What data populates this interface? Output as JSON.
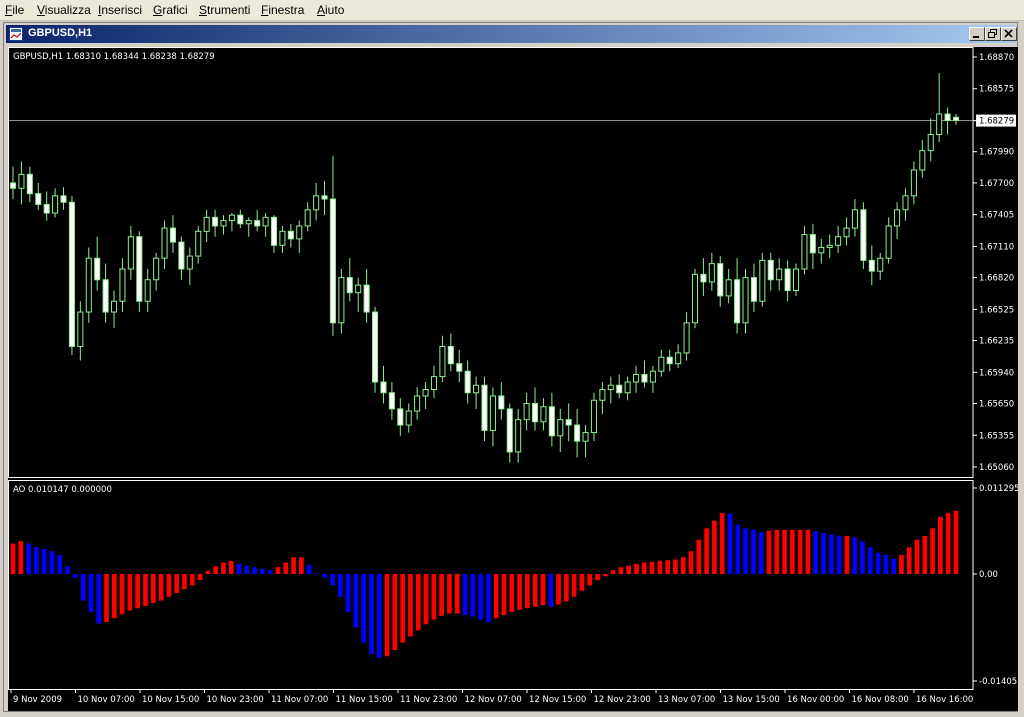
{
  "menu": {
    "items": [
      {
        "label": "File",
        "mn": "F",
        "rest": "ile"
      },
      {
        "label": "Visualizza",
        "mn": "V",
        "rest": "isualizza"
      },
      {
        "label": "Inserisci",
        "mn": "I",
        "rest": "nserisci"
      },
      {
        "label": "Grafici",
        "mn": "G",
        "rest": "rafici"
      },
      {
        "label": "Strumenti",
        "mn": "S",
        "rest": "trumenti"
      },
      {
        "label": "Finestra",
        "mn": "F",
        "rest": "inestra"
      },
      {
        "label": "Aiuto",
        "mn": "A",
        "rest": "iuto"
      }
    ]
  },
  "window": {
    "title": "GBPUSD,H1",
    "icon": "chart-window-icon",
    "buttons": [
      "minimize-icon",
      "restore-icon",
      "close-icon"
    ]
  },
  "chart_data": [
    {
      "type": "candlestick",
      "info": "GBPUSD,H1  1.68310 1.68344 1.68238 1.68279",
      "ylim": [
        1.6506,
        1.6887
      ],
      "yticks": [
        "1.68870",
        "1.68575",
        "1.68279",
        "1.67990",
        "1.67700",
        "1.67405",
        "1.67110",
        "1.66820",
        "1.66525",
        "1.66235",
        "1.65940",
        "1.65650",
        "1.65355",
        "1.65060"
      ],
      "current_price": "1.68279",
      "current_price_value": 1.68279,
      "colors": {
        "up": "#90ee90",
        "down": "#90ee90",
        "body_up": "#000000",
        "body_down": "#ffffff",
        "price_line": "#c0c0c0",
        "axis": "#ffffff"
      },
      "candles": [
        [
          1.677,
          1.6785,
          1.6755,
          1.6765
        ],
        [
          1.6765,
          1.679,
          1.675,
          1.6778
        ],
        [
          1.6778,
          1.6785,
          1.6752,
          1.676
        ],
        [
          1.676,
          1.677,
          1.6745,
          1.675
        ],
        [
          1.675,
          1.6762,
          1.6735,
          1.6742
        ],
        [
          1.6742,
          1.6765,
          1.6738,
          1.6758
        ],
        [
          1.6758,
          1.6766,
          1.6745,
          1.6752
        ],
        [
          1.6752,
          1.6758,
          1.661,
          1.6618
        ],
        [
          1.6618,
          1.666,
          1.6605,
          1.665
        ],
        [
          1.665,
          1.671,
          1.664,
          1.67
        ],
        [
          1.67,
          1.672,
          1.667,
          1.668
        ],
        [
          1.668,
          1.6695,
          1.664,
          1.665
        ],
        [
          1.665,
          1.667,
          1.6635,
          1.666
        ],
        [
          1.666,
          1.67,
          1.665,
          1.669
        ],
        [
          1.669,
          1.673,
          1.668,
          1.672
        ],
        [
          1.672,
          1.6725,
          1.665,
          1.666
        ],
        [
          1.666,
          1.669,
          1.665,
          1.668
        ],
        [
          1.668,
          1.6705,
          1.667,
          1.67
        ],
        [
          1.67,
          1.6735,
          1.669,
          1.6728
        ],
        [
          1.6728,
          1.674,
          1.6705,
          1.6715
        ],
        [
          1.6715,
          1.672,
          1.668,
          1.669
        ],
        [
          1.669,
          1.671,
          1.6675,
          1.6702
        ],
        [
          1.6702,
          1.673,
          1.6695,
          1.6725
        ],
        [
          1.6725,
          1.6745,
          1.6715,
          1.6738
        ],
        [
          1.6738,
          1.6745,
          1.672,
          1.673
        ],
        [
          1.673,
          1.674,
          1.6722,
          1.6735
        ],
        [
          1.6735,
          1.6742,
          1.6725,
          1.674
        ],
        [
          1.674,
          1.6745,
          1.6728,
          1.6732
        ],
        [
          1.6732,
          1.6738,
          1.672,
          1.6735
        ],
        [
          1.6735,
          1.6745,
          1.6725,
          1.673
        ],
        [
          1.673,
          1.6742,
          1.672,
          1.6738
        ],
        [
          1.6738,
          1.674,
          1.6705,
          1.6712
        ],
        [
          1.6712,
          1.673,
          1.6705,
          1.6725
        ],
        [
          1.6725,
          1.6732,
          1.671,
          1.6718
        ],
        [
          1.6718,
          1.6735,
          1.6705,
          1.673
        ],
        [
          1.673,
          1.6752,
          1.6725,
          1.6745
        ],
        [
          1.6745,
          1.677,
          1.6735,
          1.6758
        ],
        [
          1.6758,
          1.6772,
          1.674,
          1.6755
        ],
        [
          1.6755,
          1.6795,
          1.6628,
          1.664
        ],
        [
          1.664,
          1.669,
          1.663,
          1.6682
        ],
        [
          1.6682,
          1.67,
          1.666,
          1.6668
        ],
        [
          1.6668,
          1.6682,
          1.665,
          1.6675
        ],
        [
          1.6675,
          1.669,
          1.664,
          1.665
        ],
        [
          1.665,
          1.6655,
          1.6575,
          1.6585
        ],
        [
          1.6585,
          1.66,
          1.6565,
          1.6575
        ],
        [
          1.6575,
          1.6585,
          1.655,
          1.656
        ],
        [
          1.656,
          1.657,
          1.6535,
          1.6545
        ],
        [
          1.6545,
          1.6565,
          1.6538,
          1.6558
        ],
        [
          1.6558,
          1.658,
          1.655,
          1.6572
        ],
        [
          1.6572,
          1.6585,
          1.656,
          1.6578
        ],
        [
          1.6578,
          1.66,
          1.657,
          1.659
        ],
        [
          1.659,
          1.6628,
          1.6585,
          1.6618
        ],
        [
          1.6618,
          1.663,
          1.6595,
          1.6602
        ],
        [
          1.6602,
          1.6615,
          1.6585,
          1.6595
        ],
        [
          1.6595,
          1.6605,
          1.6565,
          1.6575
        ],
        [
          1.6575,
          1.659,
          1.656,
          1.6582
        ],
        [
          1.6582,
          1.659,
          1.653,
          1.654
        ],
        [
          1.654,
          1.658,
          1.6525,
          1.6572
        ],
        [
          1.6572,
          1.6585,
          1.655,
          1.656
        ],
        [
          1.656,
          1.6565,
          1.651,
          1.652
        ],
        [
          1.652,
          1.656,
          1.651,
          1.655
        ],
        [
          1.655,
          1.6575,
          1.654,
          1.6565
        ],
        [
          1.6565,
          1.658,
          1.654,
          1.6548
        ],
        [
          1.6548,
          1.657,
          1.654,
          1.6562
        ],
        [
          1.6562,
          1.6575,
          1.6525,
          1.6535
        ],
        [
          1.6535,
          1.656,
          1.652,
          1.655
        ],
        [
          1.655,
          1.6565,
          1.653,
          1.6545
        ],
        [
          1.6545,
          1.656,
          1.6515,
          1.653
        ],
        [
          1.653,
          1.6545,
          1.6515,
          1.6538
        ],
        [
          1.6538,
          1.6575,
          1.653,
          1.6568
        ],
        [
          1.6568,
          1.6585,
          1.6555,
          1.6578
        ],
        [
          1.6578,
          1.659,
          1.6565,
          1.6582
        ],
        [
          1.6582,
          1.6592,
          1.657,
          1.6575
        ],
        [
          1.6575,
          1.659,
          1.6568,
          1.6585
        ],
        [
          1.6585,
          1.66,
          1.6575,
          1.6592
        ],
        [
          1.6592,
          1.6605,
          1.658,
          1.6585
        ],
        [
          1.6585,
          1.66,
          1.6575,
          1.6595
        ],
        [
          1.6595,
          1.6615,
          1.659,
          1.6608
        ],
        [
          1.6608,
          1.6615,
          1.6595,
          1.6602
        ],
        [
          1.6602,
          1.662,
          1.6598,
          1.6612
        ],
        [
          1.6612,
          1.665,
          1.6605,
          1.664
        ],
        [
          1.664,
          1.669,
          1.6635,
          1.6685
        ],
        [
          1.6685,
          1.67,
          1.6665,
          1.6678
        ],
        [
          1.6678,
          1.6705,
          1.667,
          1.6695
        ],
        [
          1.6695,
          1.6702,
          1.6655,
          1.6665
        ],
        [
          1.6665,
          1.669,
          1.6658,
          1.668
        ],
        [
          1.668,
          1.67,
          1.663,
          1.664
        ],
        [
          1.664,
          1.669,
          1.663,
          1.6682
        ],
        [
          1.6682,
          1.6695,
          1.665,
          1.666
        ],
        [
          1.666,
          1.6705,
          1.6655,
          1.6698
        ],
        [
          1.6698,
          1.6705,
          1.667,
          1.668
        ],
        [
          1.668,
          1.67,
          1.667,
          1.669
        ],
        [
          1.669,
          1.6698,
          1.666,
          1.667
        ],
        [
          1.667,
          1.6695,
          1.6665,
          1.669
        ],
        [
          1.669,
          1.673,
          1.6685,
          1.6722
        ],
        [
          1.6722,
          1.6732,
          1.669,
          1.6705
        ],
        [
          1.6705,
          1.6718,
          1.6695,
          1.671
        ],
        [
          1.671,
          1.6722,
          1.67,
          1.6712
        ],
        [
          1.6712,
          1.673,
          1.6705,
          1.672
        ],
        [
          1.672,
          1.6738,
          1.6712,
          1.6728
        ],
        [
          1.6728,
          1.6755,
          1.672,
          1.6745
        ],
        [
          1.6745,
          1.6752,
          1.669,
          1.6698
        ],
        [
          1.6698,
          1.6712,
          1.6675,
          1.6688
        ],
        [
          1.6688,
          1.6705,
          1.668,
          1.67
        ],
        [
          1.67,
          1.6738,
          1.6695,
          1.673
        ],
        [
          1.673,
          1.6752,
          1.6718,
          1.6745
        ],
        [
          1.6745,
          1.6765,
          1.6735,
          1.6758
        ],
        [
          1.6758,
          1.679,
          1.675,
          1.6782
        ],
        [
          1.6782,
          1.681,
          1.6775,
          1.68
        ],
        [
          1.68,
          1.683,
          1.679,
          1.6815
        ],
        [
          1.6815,
          1.6872,
          1.6808,
          1.6834
        ],
        [
          1.6834,
          1.684,
          1.6815,
          1.6828
        ],
        [
          1.6831,
          1.6834,
          1.6824,
          1.6828
        ]
      ]
    },
    {
      "type": "bar",
      "indicator": "AO",
      "info": "AO 0.010147 0.000000",
      "ylim": [
        -0.01405,
        0.01129
      ],
      "yticks": [
        "0.011295",
        "0.00",
        "-0.01405"
      ],
      "colors": {
        "up": "#ff0000",
        "down": "#0000ff"
      },
      "values": [
        0.004,
        0.0043,
        0.004,
        0.0035,
        0.0033,
        0.003,
        0.0025,
        0.001,
        -0.0005,
        -0.0035,
        -0.005,
        -0.0065,
        -0.0063,
        -0.0058,
        -0.0053,
        -0.0048,
        -0.0045,
        -0.0042,
        -0.0038,
        -0.0035,
        -0.003,
        -0.0025,
        -0.002,
        -0.0015,
        -0.0008,
        0.0004,
        0.001,
        0.0015,
        0.0017,
        0.0013,
        0.0011,
        0.0009,
        0.0007,
        0.0005,
        0.0009,
        0.0015,
        0.0022,
        0.0022,
        0.0012,
        0.0001,
        -0.0005,
        -0.0015,
        -0.003,
        -0.005,
        -0.007,
        -0.009,
        -0.0105,
        -0.011,
        -0.0108,
        -0.01,
        -0.009,
        -0.0082,
        -0.0074,
        -0.0066,
        -0.006,
        -0.0055,
        -0.0052,
        -0.0052,
        -0.0054,
        -0.0056,
        -0.006,
        -0.0063,
        -0.0058,
        -0.0054,
        -0.005,
        -0.0047,
        -0.0045,
        -0.0043,
        -0.0041,
        -0.0043,
        -0.004,
        -0.0036,
        -0.003,
        -0.0022,
        -0.0015,
        -0.0008,
        -0.0003,
        0.0005,
        0.0009,
        0.0011,
        0.0013,
        0.0015,
        0.0016,
        0.0017,
        0.0018,
        0.0019,
        0.0022,
        0.003,
        0.0045,
        0.006,
        0.007,
        0.008,
        0.0079,
        0.0065,
        0.006,
        0.0058,
        0.0055,
        0.0057,
        0.0058,
        0.0058,
        0.0058,
        0.0058,
        0.0058,
        0.0056,
        0.0054,
        0.0052,
        0.005,
        0.005,
        0.0048,
        0.0043,
        0.0035,
        0.0028,
        0.0025,
        0.002,
        0.0025,
        0.0035,
        0.0045,
        0.005,
        0.006,
        0.0075,
        0.008,
        0.0083
      ]
    }
  ],
  "xaxis": {
    "labels": [
      "9 Nov 2009",
      "10 Nov 07:00",
      "10 Nov 15:00",
      "10 Nov 23:00",
      "11 Nov 07:00",
      "11 Nov 15:00",
      "11 Nov 23:00",
      "12 Nov 07:00",
      "12 Nov 15:00",
      "12 Nov 23:00",
      "13 Nov 07:00",
      "13 Nov 15:00",
      "16 Nov 00:00",
      "16 Nov 08:00",
      "16 Nov 16:00"
    ]
  }
}
